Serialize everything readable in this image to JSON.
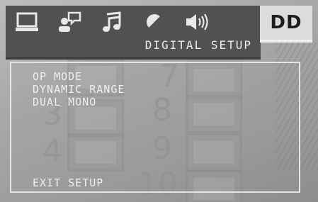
{
  "tabs": [
    {
      "icon": "monitor-icon"
    },
    {
      "icon": "language-icon"
    },
    {
      "icon": "music-note-icon"
    },
    {
      "icon": "color-circle-icon"
    },
    {
      "icon": "speaker-icon"
    }
  ],
  "active_tab": {
    "label": "DD"
  },
  "subtitle": "DIGITAL SETUP",
  "menu": {
    "items": [
      "OP MODE",
      "DYNAMIC RANGE",
      "DUAL MONO"
    ],
    "exit": "EXIT SETUP"
  },
  "background_numbers": [
    "7",
    "8",
    "9",
    "10",
    "3",
    "4"
  ]
}
